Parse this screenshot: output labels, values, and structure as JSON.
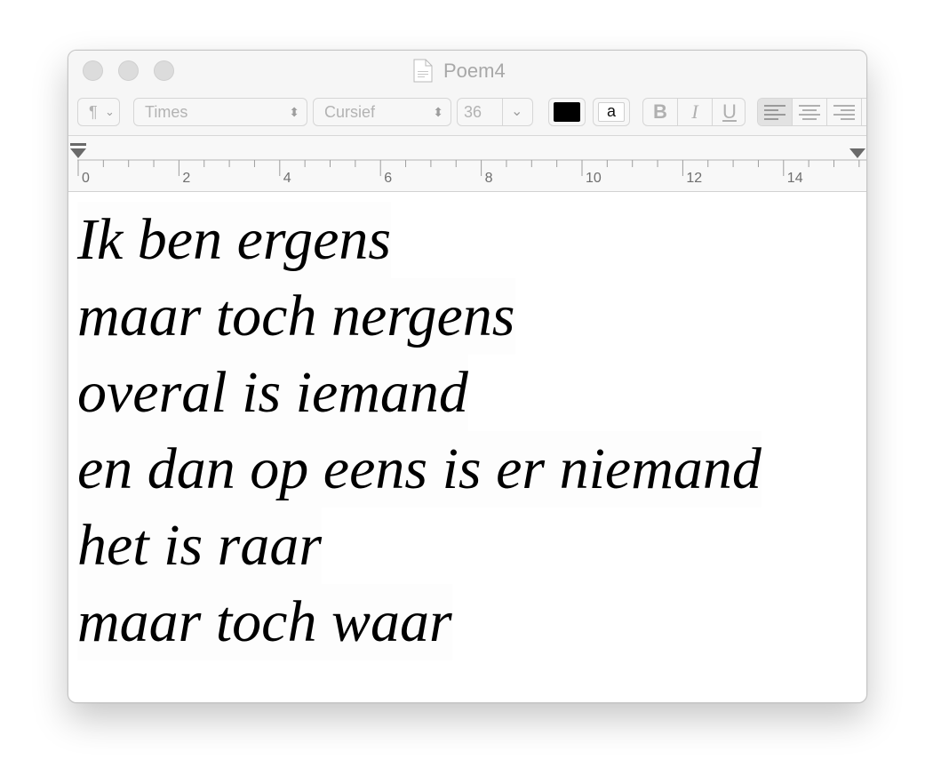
{
  "window": {
    "title": "Poem4"
  },
  "toolbar": {
    "paragraph_symbol": "¶",
    "font_family": "Times",
    "typeface": "Cursief",
    "font_size": "36",
    "bg_color_glyph": "a",
    "bold": "B",
    "italic": "I",
    "underline": "U",
    "text_color": "#000000",
    "alignment_selected": "left"
  },
  "ruler": {
    "labels": [
      "0",
      "2",
      "4",
      "6",
      "8",
      "10",
      "12",
      "14"
    ]
  },
  "document": {
    "lines": [
      "Ik ben ergens",
      "maar toch nergens",
      "overal is iemand",
      "en dan op eens is er niemand",
      "het is raar",
      "maar toch waar"
    ]
  }
}
